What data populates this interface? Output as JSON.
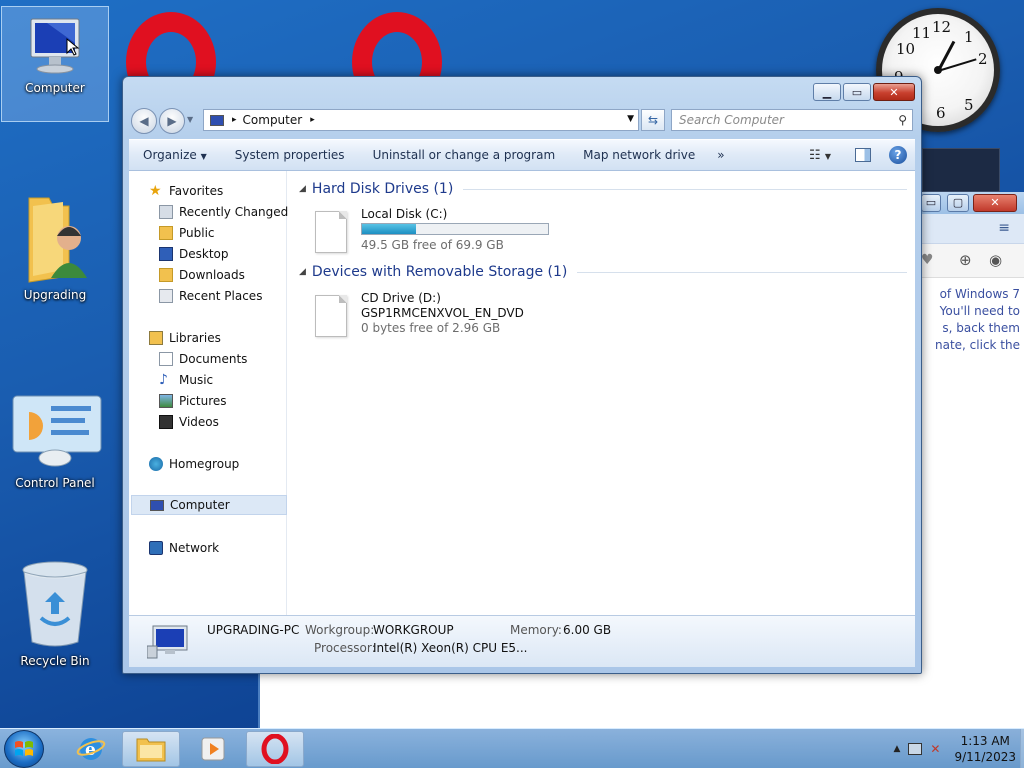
{
  "desktop": {
    "icons": [
      {
        "label": "Computer"
      },
      {
        "label": "Upgrading"
      },
      {
        "label": "Control Panel"
      },
      {
        "label": "Recycle Bin"
      }
    ]
  },
  "background_browser": {
    "text_lines": [
      "of Windows 7",
      "You'll need to",
      "s, back them",
      "nate, click the"
    ]
  },
  "explorer": {
    "address": {
      "crumb_sep": "▸",
      "location": "Computer"
    },
    "search_placeholder": "Search Computer",
    "toolbar": {
      "organize": "Organize",
      "system_properties": "System properties",
      "uninstall": "Uninstall or change a program",
      "map_drive": "Map network drive",
      "more": "»"
    },
    "nav": {
      "favorites": "Favorites",
      "recently_changed": "Recently Changed",
      "public": "Public",
      "desktop": "Desktop",
      "downloads": "Downloads",
      "recent_places": "Recent Places",
      "libraries": "Libraries",
      "documents": "Documents",
      "music": "Music",
      "pictures": "Pictures",
      "videos": "Videos",
      "homegroup": "Homegroup",
      "computer": "Computer",
      "network": "Network"
    },
    "groups": {
      "hdd": {
        "header": "Hard Disk Drives (1)",
        "drive_name": "Local Disk (C:)",
        "free": "49.5 GB free of 69.9 GB",
        "used_fraction": 0.29
      },
      "removable": {
        "header": "Devices with Removable Storage (1)",
        "drive_name": "CD Drive (D:)",
        "volume": "GSP1RMCENXVOL_EN_DVD",
        "free": "0 bytes free of 2.96 GB"
      }
    },
    "details": {
      "pc_name": "UPGRADING-PC",
      "workgroup_label": "Workgroup:",
      "workgroup": "WORKGROUP",
      "memory_label": "Memory:",
      "memory": "6.00 GB",
      "processor_label": "Processor:",
      "processor": "Intel(R) Xeon(R) CPU E5..."
    }
  },
  "taskbar": {
    "time": "1:13 AM",
    "date": "9/11/2023"
  },
  "colors": {
    "accent": "#1e3a8c",
    "opera_red": "#e01020",
    "drive_bar": "#1c8fc2"
  }
}
